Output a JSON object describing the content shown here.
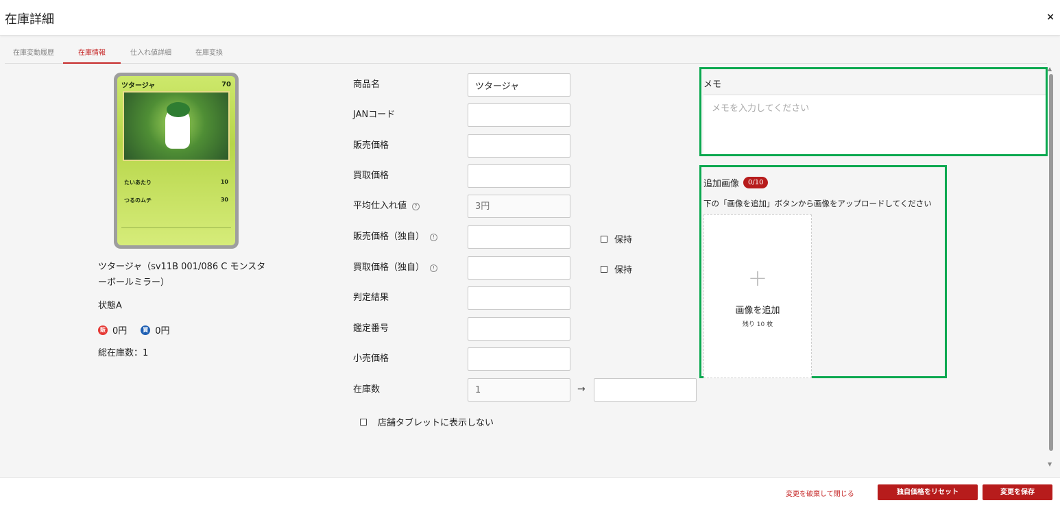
{
  "header": {
    "title": "在庫詳細",
    "close": "×"
  },
  "tabs": [
    {
      "label": "在庫変動履歴",
      "active": false
    },
    {
      "label": "在庫情報",
      "active": true
    },
    {
      "label": "仕入れ値詳細",
      "active": false
    },
    {
      "label": "在庫変換",
      "active": false
    }
  ],
  "product": {
    "card": {
      "name": "ツタージャ",
      "hp": "70",
      "move1": "たいあたり",
      "move1_dmg": "10",
      "move2": "つるのムチ",
      "move2_dmg": "30"
    },
    "name": "ツタージャ（sv11B 001/086 C モンスターボールミラー）",
    "state": "状態A",
    "sell_badge": "販",
    "sell_price": "0円",
    "buy_badge": "買",
    "buy_price": "0円",
    "total_stock": "総在庫数：1"
  },
  "form": {
    "product_name_label": "商品名",
    "product_name_value": "ツタージャ",
    "jan_label": "JANコード",
    "jan_value": "",
    "sell_price_label": "販売価格",
    "sell_price_value": "",
    "buy_price_label": "買取価格",
    "buy_price_value": "",
    "avg_cost_label": "平均仕入れ値",
    "avg_cost_placeholder": "3円",
    "sell_custom_label": "販売価格（独自）",
    "sell_custom_value": "",
    "buy_custom_label": "買取価格（独自）",
    "buy_custom_value": "",
    "keep_label": "保持",
    "judge_label": "判定結果",
    "judge_value": "",
    "appraisal_label": "鑑定番号",
    "appraisal_value": "",
    "retail_label": "小売価格",
    "retail_value": "",
    "stock_label": "在庫数",
    "stock_current": "1",
    "stock_arrow": "→",
    "stock_new": "",
    "tablet_hide_label": "店舗タブレットに表示しない"
  },
  "memo": {
    "label": "メモ",
    "placeholder": "メモを入力してください"
  },
  "images": {
    "label": "追加画像",
    "count": "0/10",
    "hint": "下の「画像を追加」ボタンから画像をアップロードしてください",
    "plus": "+",
    "add_label": "画像を追加",
    "remaining": "残り 10 枚"
  },
  "footer": {
    "discard": "変更を破棄して閉じる",
    "reset": "独自価格をリセット",
    "save": "変更を保存"
  },
  "colors": {
    "accent": "#b71c1c",
    "highlight": "#0aa84f",
    "sell_badge": "#e53935",
    "buy_badge": "#1e5fb3"
  },
  "icons": {
    "info": "info-icon",
    "help": "help-icon",
    "close": "close-icon"
  }
}
